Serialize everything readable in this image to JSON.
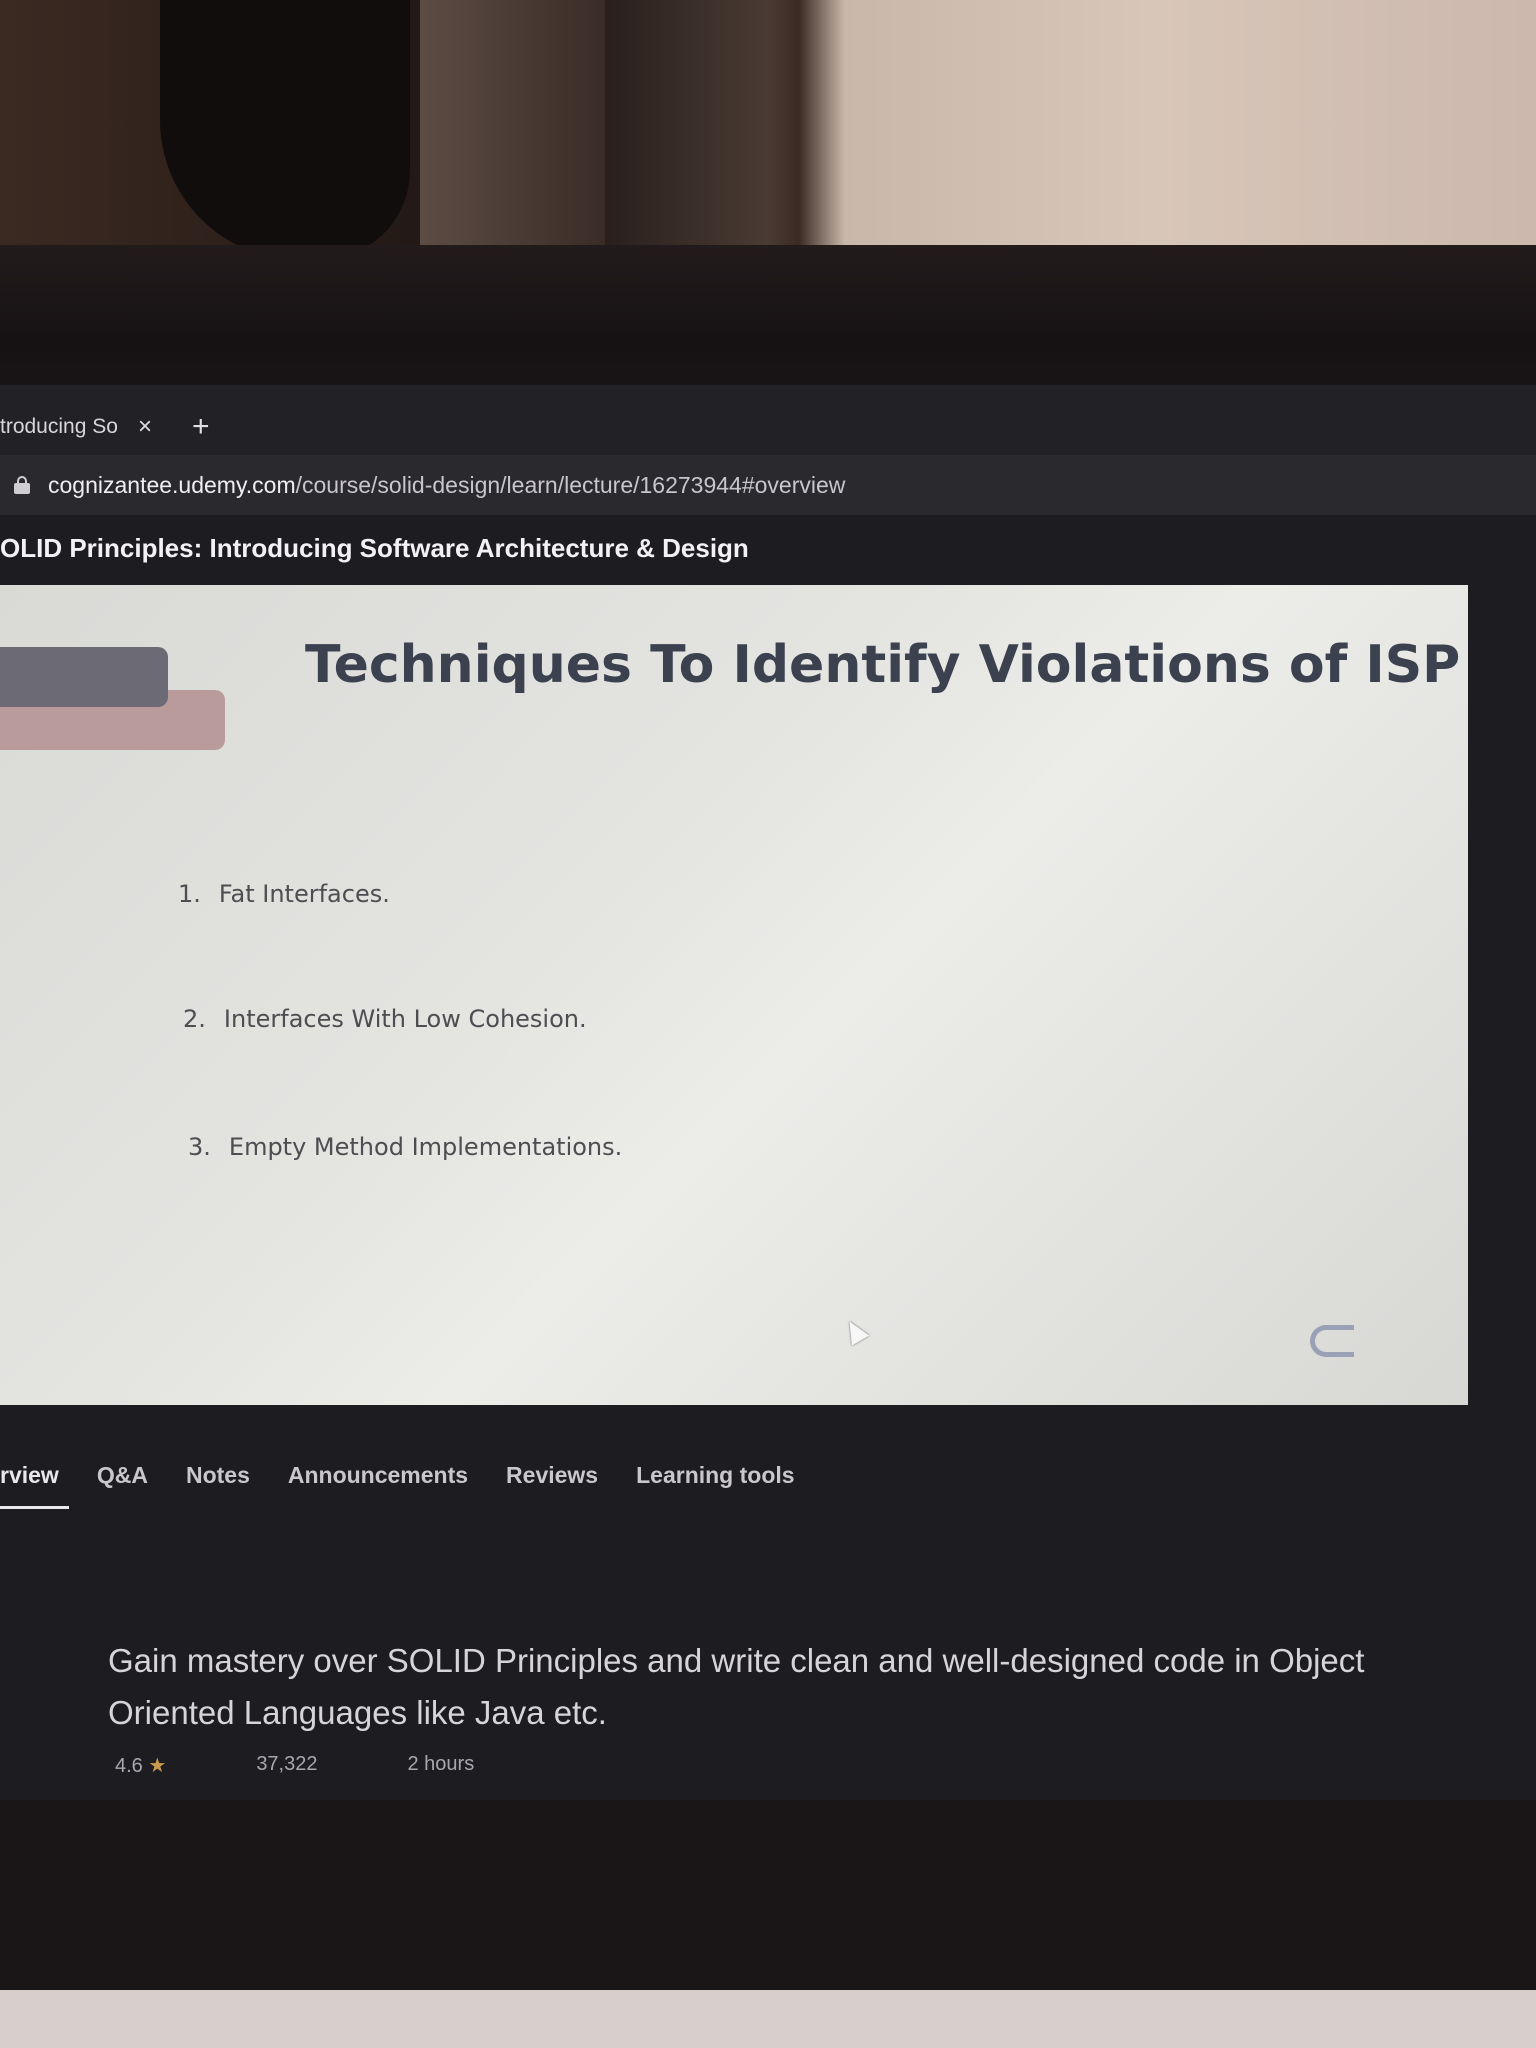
{
  "browser": {
    "tab_title": "troducing So",
    "close_symbol": "×",
    "new_tab_symbol": "+",
    "url_host": "cognizantee.udemy.com",
    "url_path": "/course/solid-design/learn/lecture/16273944#overview"
  },
  "course": {
    "title": "OLID Principles: Introducing Software Architecture & Design"
  },
  "slide": {
    "title": "Techniques To Identify Violations of ISP",
    "items": [
      {
        "num": "1.",
        "text": "Fat Interfaces."
      },
      {
        "num": "2.",
        "text": "Interfaces With Low Cohesion."
      },
      {
        "num": "3.",
        "text": "Empty Method Implementations."
      }
    ]
  },
  "lecture_tabs": [
    {
      "label": "rview",
      "active": true
    },
    {
      "label": "Q&A"
    },
    {
      "label": "Notes"
    },
    {
      "label": "Announcements"
    },
    {
      "label": "Reviews"
    },
    {
      "label": "Learning tools"
    }
  ],
  "overview": {
    "description": "Gain mastery over SOLID Principles and write clean and well-designed code in Object Oriented Languages like Java etc.",
    "rating": "4.6",
    "students": "37,322",
    "duration": "2 hours"
  },
  "colors": {
    "screen_bg": "#1d1c20",
    "slide_title": "#3c4150"
  }
}
